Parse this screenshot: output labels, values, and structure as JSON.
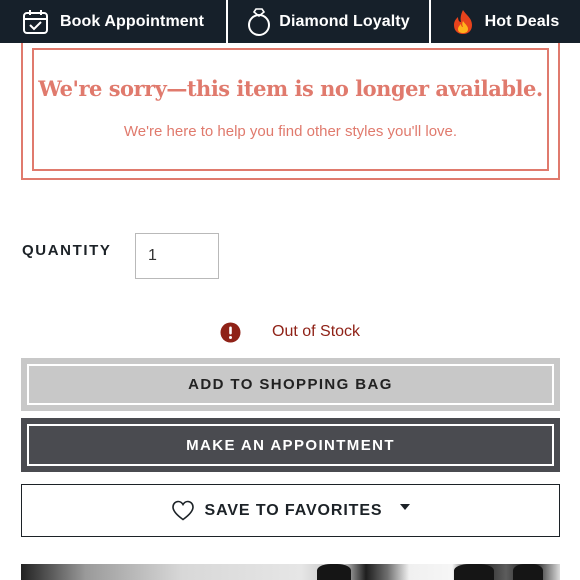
{
  "nav": {
    "items": [
      {
        "label": "Book Appointment",
        "icon": "calendar-check-icon"
      },
      {
        "label": "Diamond Loyalty",
        "icon": "diamond-ring-icon"
      },
      {
        "label": "Hot Deals",
        "icon": "flame-icon"
      }
    ]
  },
  "notice": {
    "title": "We're sorry—this item is no longer available.",
    "subtitle": "We're here to help you find other styles you'll love."
  },
  "quantity": {
    "label": "QUANTITY",
    "value": "1"
  },
  "stock": {
    "icon": "alert-circle-icon",
    "text": "Out of Stock"
  },
  "actions": {
    "add_to_bag": "ADD TO SHOPPING BAG",
    "make_appointment": "MAKE AN APPOINTMENT",
    "save_to_favorites": "SAVE TO FAVORITES",
    "favorites_icon": "heart-icon",
    "dropdown_icon": "caret-down-icon"
  },
  "colors": {
    "nav_bg": "#16202a",
    "notice_accent": "#e07a6d",
    "stock_alert": "#8f2217",
    "bag_button_bg": "#c8c8c8",
    "appointment_button_bg": "#4a4b50"
  }
}
